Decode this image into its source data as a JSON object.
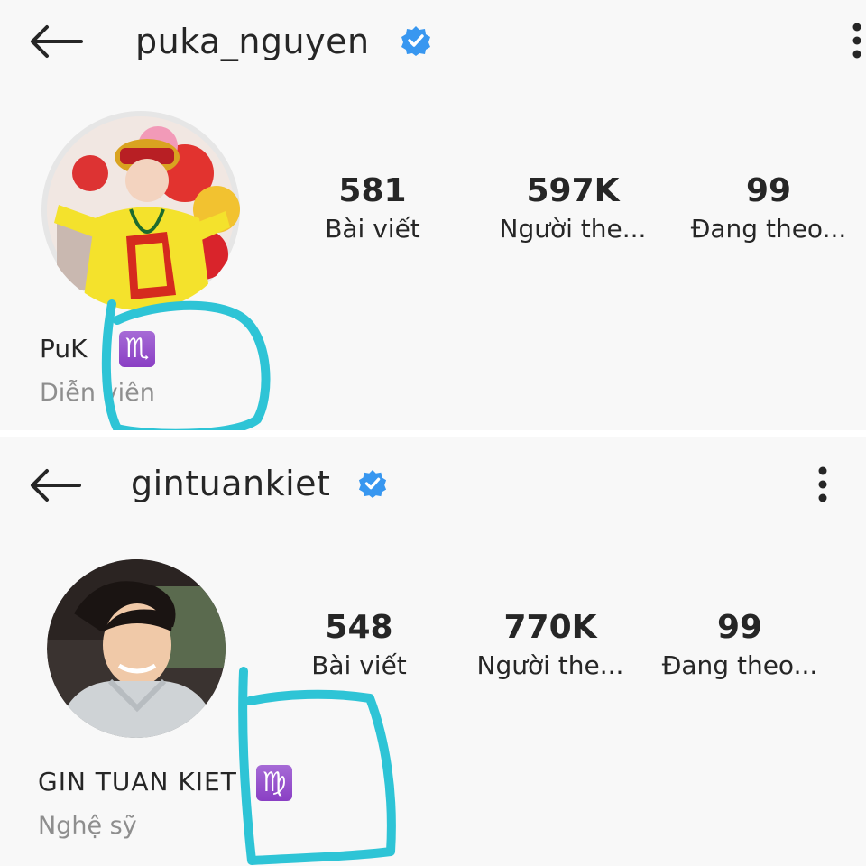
{
  "profiles": [
    {
      "username": "puka_nguyen",
      "verified": true,
      "stats": [
        {
          "value": "581",
          "label": "Bài viết"
        },
        {
          "value": "597K",
          "label": "Người the..."
        },
        {
          "value": "99",
          "label": "Đang theo..."
        }
      ],
      "display_name": "PuK",
      "zodiac_symbol": "♏",
      "category": "Diễn viên",
      "avatar_icon": "profile-photo-woman-yellow-ao-dai"
    },
    {
      "username": "gintuankiet",
      "verified": true,
      "stats": [
        {
          "value": "548",
          "label": "Bài viết"
        },
        {
          "value": "770K",
          "label": "Người the..."
        },
        {
          "value": "99",
          "label": "Đang theo..."
        }
      ],
      "display_name": "GIN TUAN KIET",
      "zodiac_symbol": "♍",
      "category": "Nghệ sỹ",
      "avatar_icon": "profile-photo-man-hoodie"
    }
  ],
  "colors": {
    "verified": "#3897f0",
    "annotation": "#2ec4d6",
    "zodiac_badge": "#9b4fd1",
    "text": "#262626",
    "muted": "#8e8e8e"
  }
}
